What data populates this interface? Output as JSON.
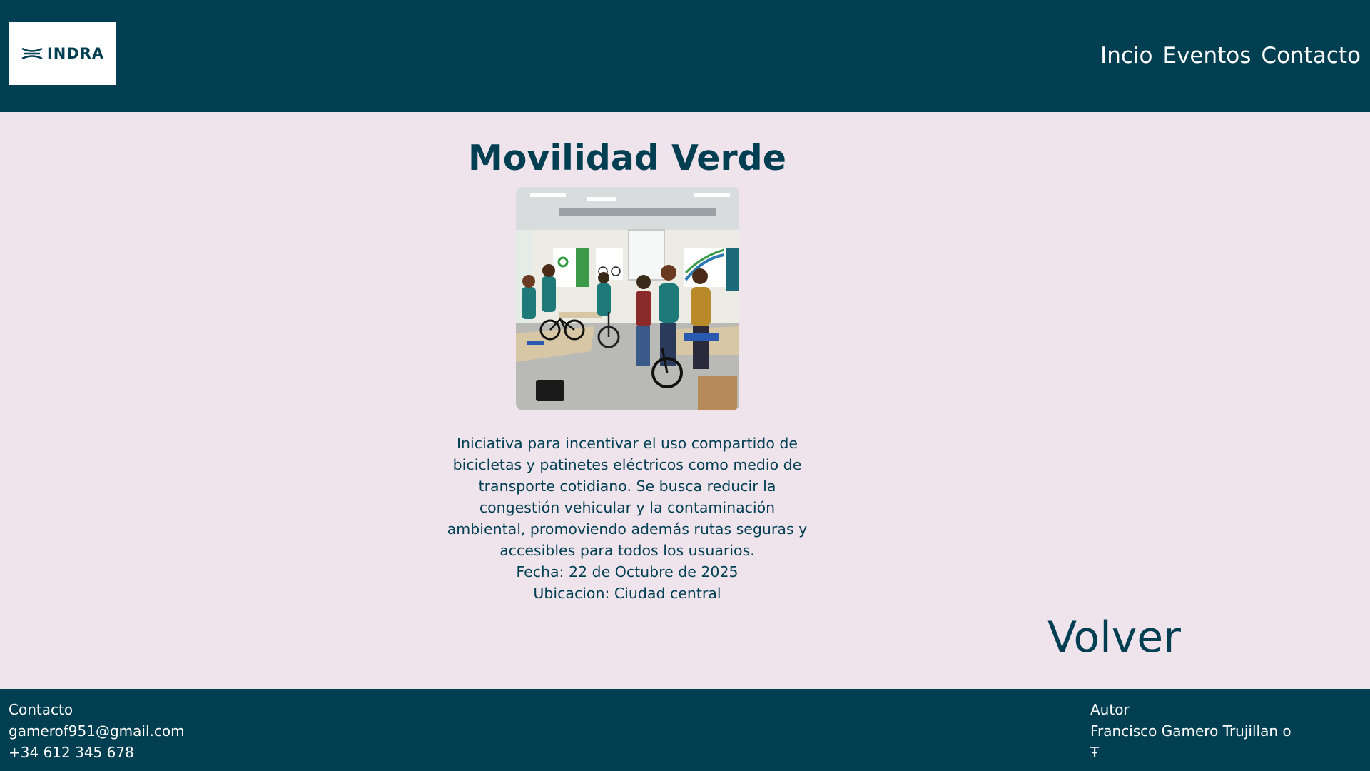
{
  "header": {
    "logo_text": "INDRA",
    "nav": [
      {
        "label": "Incio"
      },
      {
        "label": "Eventos"
      },
      {
        "label": "Contacto"
      }
    ]
  },
  "event": {
    "title": "Movilidad Verde",
    "description": "Iniciativa para incentivar el uso compartido de bicicletas y patinetes eléctricos como medio de transporte cotidiano. Se busca reducir la congestión vehicular y la contaminación ambiental, promoviendo además rutas seguras y accesibles para todos los usuarios.",
    "date": "Fecha: 22 de Octubre de 2025",
    "location": "Ubicacion: Ciudad central",
    "back_label": "Volver"
  },
  "footer": {
    "contact": {
      "heading": "Contacto",
      "email": "gamerof951@gmail.com",
      "phone": "+34 612 345 678"
    },
    "author": {
      "heading": "Autor",
      "name": "Francisco Gamero Trujillan o",
      "symbol": "Ŧ"
    }
  },
  "colors": {
    "primary": "#003f52",
    "background": "#f0e4ec",
    "header_text": "#ffffff"
  }
}
